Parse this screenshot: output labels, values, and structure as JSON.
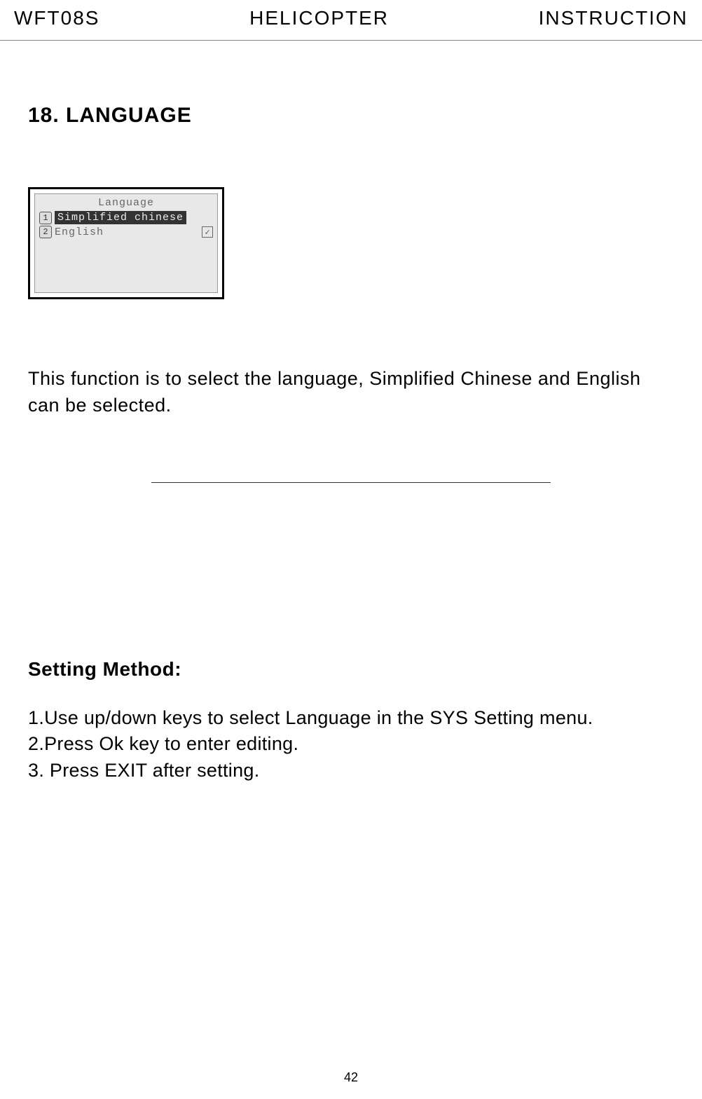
{
  "header": {
    "left": "WFT08S",
    "center": "HELICOPTER",
    "right": "INSTRUCTION"
  },
  "section_title": "18. LANGUAGE",
  "lcd": {
    "title": "Language",
    "row1_num": "1",
    "row1_text": "Simplified chinese",
    "row2_num": "2",
    "row2_text": "English",
    "check": "✓"
  },
  "description": "This function is to select the language, Simplified Chinese and English can be selected.",
  "setting_heading": "Setting Method:",
  "steps": {
    "s1": "1.Use up/down keys  to select Language in the SYS Setting menu.",
    "s2": "2.Press Ok key to enter editing.",
    "s3": "3. Press EXIT after setting."
  },
  "page_number": "42"
}
